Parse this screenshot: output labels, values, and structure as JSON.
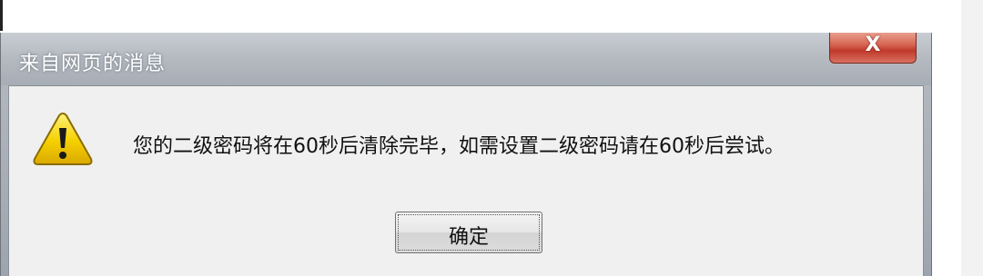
{
  "dialog": {
    "title": "来自网页的消息",
    "close_glyph": "X",
    "icon": "warning-icon",
    "message": "您的二级密码将在60秒后清除完毕，如需设置二级密码请在60秒后尝试。",
    "ok_label": "确定"
  },
  "colors": {
    "close_button": "#c0392b",
    "warning_fill": "#f5d000",
    "titlebar": "#b6bbc2",
    "content_bg": "#f0f0f0"
  }
}
